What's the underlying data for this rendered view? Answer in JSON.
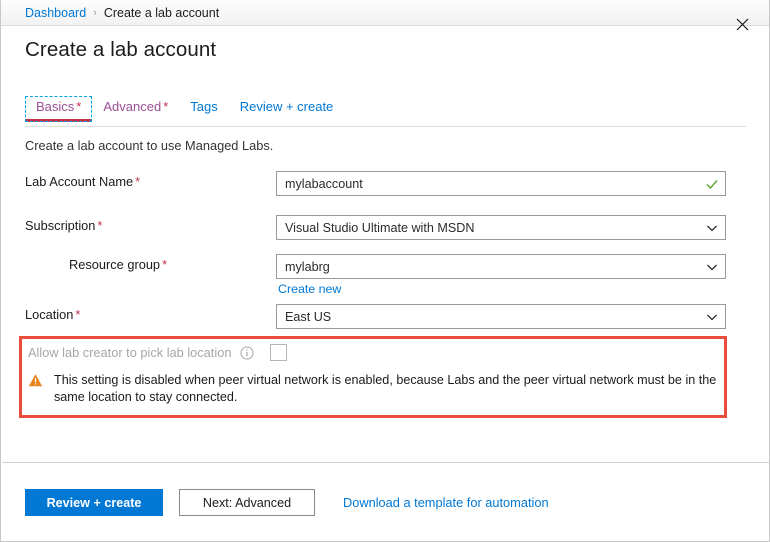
{
  "breadcrumb": {
    "root_label": "Dashboard",
    "separator": "›",
    "current_label": "Create a lab account"
  },
  "header": {
    "title": "Create a lab account",
    "close_icon": "close-icon"
  },
  "tabs": [
    {
      "label": "Basics",
      "required_marker": "*",
      "state": "selected"
    },
    {
      "label": "Advanced",
      "required_marker": "*",
      "state": "visited"
    },
    {
      "label": "Tags",
      "required_marker": "",
      "state": "default"
    },
    {
      "label": "Review + create",
      "required_marker": "",
      "state": "default"
    }
  ],
  "form": {
    "description": "Create a lab account to use Managed Labs.",
    "fields": [
      {
        "label": "Lab Account Name",
        "required_marker": "*",
        "value": "mylabaccount",
        "control": "text",
        "status_icon": "check-icon"
      },
      {
        "label": "Subscription",
        "required_marker": "*",
        "value": "Visual Studio Ultimate with MSDN",
        "control": "select",
        "status_icon": "chevron-down-icon"
      },
      {
        "label": "Resource group",
        "required_marker": "*",
        "value": "mylabrg",
        "control": "select",
        "status_icon": "chevron-down-icon",
        "sublink": "Create new"
      },
      {
        "label": "Location",
        "required_marker": "*",
        "value": "East US",
        "control": "select",
        "status_icon": "chevron-down-icon"
      }
    ]
  },
  "disabled_section": {
    "allow_label": "Allow lab creator to pick lab location",
    "info_icon": "info-icon",
    "checkbox_checked": false,
    "warning_icon": "warning-icon",
    "warning_text": "This setting is disabled when peer virtual network is enabled, because Labs and the peer virtual network must be in the same location to stay connected."
  },
  "footer": {
    "primary_button": "Review + create",
    "secondary_button": "Next: Advanced",
    "template_link": "Download a template for automation"
  },
  "colors": {
    "accent_blue": "#0078d4",
    "link_blue": "#0078d4",
    "visited_purple": "#9b4f96",
    "required_red": "#c4314b",
    "highlight_red": "#e74c3c",
    "warning_orange": "#e8821e",
    "success_green": "#5aa535"
  }
}
